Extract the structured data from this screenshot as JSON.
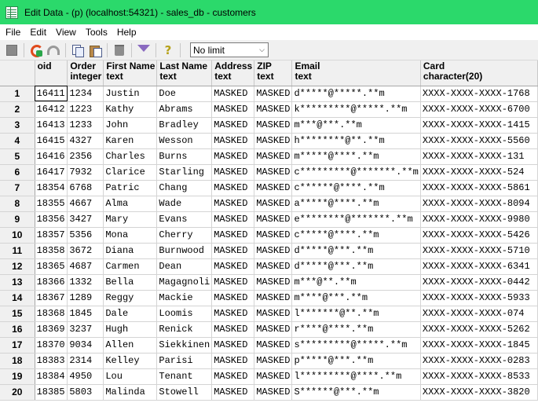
{
  "window": {
    "title": "Edit Data - (p) (localhost:54321) - sales_db - customers"
  },
  "menu": [
    "File",
    "Edit",
    "View",
    "Tools",
    "Help"
  ],
  "toolbar": {
    "icons": [
      "stop-icon",
      "refresh-icon",
      "undo-icon",
      "copy-icon",
      "paste-icon",
      "delete-icon",
      "filter-icon",
      "help-icon"
    ],
    "limit_value": "No limit"
  },
  "grid": {
    "columns": [
      {
        "line1": "oid",
        "line2": ""
      },
      {
        "line1": "Order",
        "line2": "integer"
      },
      {
        "line1": "First Name",
        "line2": "text"
      },
      {
        "line1": "Last Name",
        "line2": "text"
      },
      {
        "line1": "Address",
        "line2": "text"
      },
      {
        "line1": "ZIP",
        "line2": "text"
      },
      {
        "line1": "Email",
        "line2": "text"
      },
      {
        "line1": "Card",
        "line2": "character(20)"
      }
    ],
    "rows": [
      [
        "1",
        "16411",
        "1234",
        "Justin",
        "Doe",
        "MASKED",
        "MASKED",
        "d*****@*****.**m",
        "XXXX-XXXX-XXXX-1768"
      ],
      [
        "2",
        "16412",
        "1223",
        "Kathy",
        "Abrams",
        "MASKED",
        "MASKED",
        "k*********@*****.**m",
        "XXXX-XXXX-XXXX-6700"
      ],
      [
        "3",
        "16413",
        "1233",
        "John",
        "Bradley",
        "MASKED",
        "MASKED",
        "m***@***.**m",
        "XXXX-XXXX-XXXX-1415"
      ],
      [
        "4",
        "16415",
        "4327",
        "Karen",
        "Wesson",
        "MASKED",
        "MASKED",
        "h********@**.**m",
        "XXXX-XXXX-XXXX-5560"
      ],
      [
        "5",
        "16416",
        "2356",
        "Charles",
        "Burns",
        "MASKED",
        "MASKED",
        "m*****@****.**m",
        "XXXX-XXXX-XXXX-131"
      ],
      [
        "6",
        "16417",
        "7932",
        "Clarice",
        "Starling",
        "MASKED",
        "MASKED",
        "c*********@*******.**m",
        "XXXX-XXXX-XXXX-524"
      ],
      [
        "7",
        "18354",
        "6768",
        "Patric",
        "Chang",
        "MASKED",
        "MASKED",
        "c******@****.**m",
        "XXXX-XXXX-XXXX-5861"
      ],
      [
        "8",
        "18355",
        "4667",
        "Alma",
        "Wade",
        "MASKED",
        "MASKED",
        "a*****@****.**m",
        "XXXX-XXXX-XXXX-8094"
      ],
      [
        "9",
        "18356",
        "3427",
        "Mary",
        "Evans",
        "MASKED",
        "MASKED",
        "e********@*******.**m",
        "XXXX-XXXX-XXXX-9980"
      ],
      [
        "10",
        "18357",
        "5356",
        "Mona",
        "Cherry",
        "MASKED",
        "MASKED",
        "c*****@****.**m",
        "XXXX-XXXX-XXXX-5426"
      ],
      [
        "11",
        "18358",
        "3672",
        "Diana",
        "Burnwood",
        "MASKED",
        "MASKED",
        "d*****@***.**m",
        "XXXX-XXXX-XXXX-5710"
      ],
      [
        "12",
        "18365",
        "4687",
        "Carmen",
        "Dean",
        "MASKED",
        "MASKED",
        "d*****@***.**m",
        "XXXX-XXXX-XXXX-6341"
      ],
      [
        "13",
        "18366",
        "1332",
        "Bella",
        "Magagnoli",
        "MASKED",
        "MASKED",
        "m***@**.**m",
        "XXXX-XXXX-XXXX-0442"
      ],
      [
        "14",
        "18367",
        "1289",
        "Reggy",
        "Mackie",
        "MASKED",
        "MASKED",
        "m****@***.**m",
        "XXXX-XXXX-XXXX-5933"
      ],
      [
        "15",
        "18368",
        "1845",
        "Dale",
        "Loomis",
        "MASKED",
        "MASKED",
        "l*******@**.**m",
        "XXXX-XXXX-XXXX-074"
      ],
      [
        "16",
        "18369",
        "3237",
        "Hugh",
        "Renick",
        "MASKED",
        "MASKED",
        "r****@****.**m",
        "XXXX-XXXX-XXXX-5262"
      ],
      [
        "17",
        "18370",
        "9034",
        "Allen",
        "Siekkinen",
        "MASKED",
        "MASKED",
        "s*********@*****.**m",
        "XXXX-XXXX-XXXX-1845"
      ],
      [
        "18",
        "18383",
        "2314",
        "Kelley",
        "Parisi",
        "MASKED",
        "MASKED",
        "p*****@***.**m",
        "XXXX-XXXX-XXXX-0283"
      ],
      [
        "19",
        "18384",
        "4950",
        "Lou",
        "Tenant",
        "MASKED",
        "MASKED",
        "l*********@****.**m",
        "XXXX-XXXX-XXXX-8533"
      ],
      [
        "20",
        "18385",
        "5803",
        "Malinda",
        "Stowell",
        "MASKED",
        "MASKED",
        "S******@***.**m",
        "XXXX-XXXX-XXXX-3820"
      ]
    ]
  }
}
